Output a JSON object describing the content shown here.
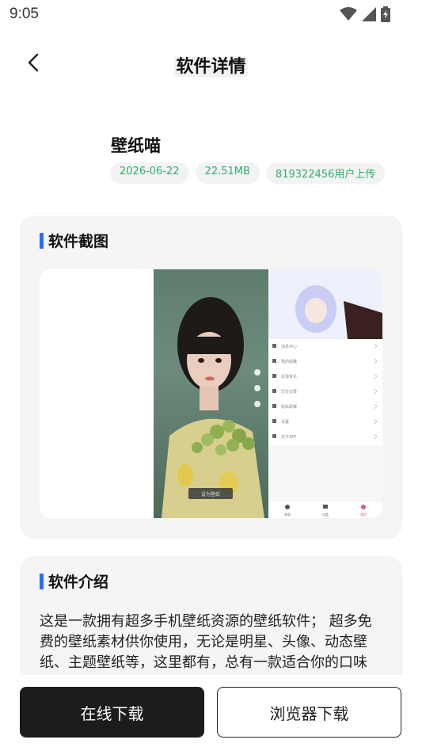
{
  "status_bar": {
    "time": "9:05"
  },
  "header": {
    "title": "软件详情"
  },
  "app": {
    "name": "壁纸喵",
    "tags": [
      "2026-06-22",
      "22.51MB",
      "819322456用户上传"
    ]
  },
  "screenshots": {
    "heading": "软件截图",
    "menu_items": [
      "消息中心",
      "我的收藏",
      "反馈意见",
      "历史记录",
      "隐私政策",
      "设置",
      "关于APP"
    ],
    "bottom_tabs": [
      "发现",
      "分类",
      "我的"
    ],
    "photo_button": "设为壁纸"
  },
  "intro": {
    "heading": "软件介绍",
    "text": "这是一款拥有超多手机壁纸资源的壁纸软件； 超多免费的壁纸素材供你使用，无论是明星、头像、动态壁纸、主题壁纸等，这里都有，总有一款适合你的口味哦！还可以轻松创建，定义制作自己独特风"
  },
  "buttons": {
    "online_download": "在线下载",
    "browser_download": "浏览器下载"
  },
  "colors": {
    "accent_blue": "#2a6df4",
    "tag_green": "#2fae6a",
    "dark_button": "#1c1c1c"
  }
}
